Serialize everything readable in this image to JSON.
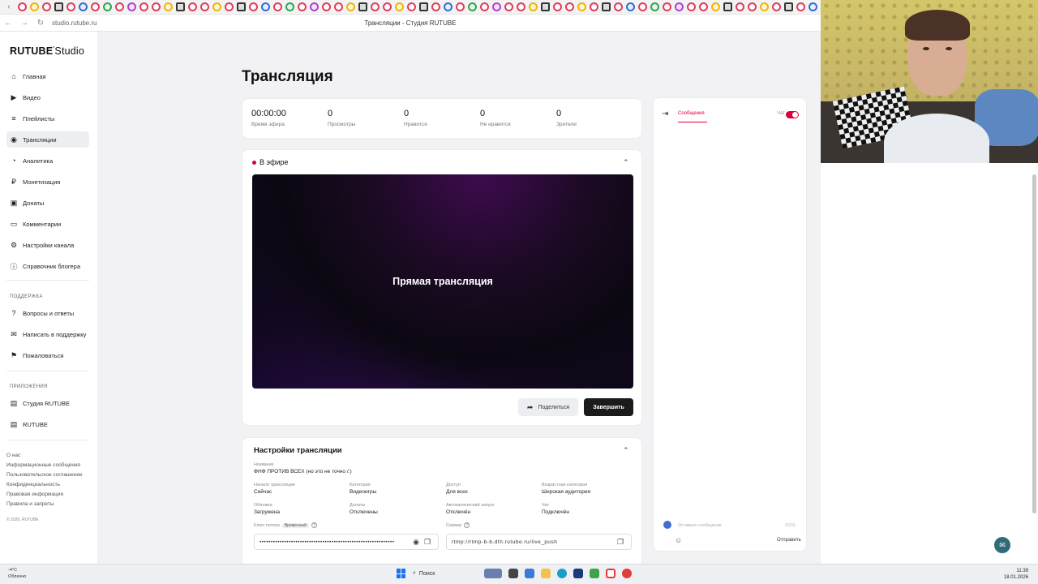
{
  "browser": {
    "url": "studio.rutube.ru",
    "page_title": "Трансляции - Студия RUTUBE"
  },
  "logo": {
    "brand": "RUTUBE",
    "product": "Studio"
  },
  "sidebar": {
    "items": [
      {
        "label": "Главная",
        "icon": "home-icon"
      },
      {
        "label": "Видео",
        "icon": "video-icon"
      },
      {
        "label": "Плейлисты",
        "icon": "playlist-icon"
      },
      {
        "label": "Трансляции",
        "icon": "broadcast-icon",
        "active": true
      },
      {
        "label": "Аналитика",
        "icon": "analytics-icon"
      },
      {
        "label": "Монетизация",
        "icon": "money-icon"
      },
      {
        "label": "Донаты",
        "icon": "donate-icon"
      },
      {
        "label": "Комментарии",
        "icon": "comments-icon"
      },
      {
        "label": "Настройки канала",
        "icon": "gear-icon"
      },
      {
        "label": "Справочник блогера",
        "icon": "info-icon"
      }
    ],
    "support_title": "ПОДДЕРЖКА",
    "support_items": [
      {
        "label": "Вопросы и ответы",
        "icon": "question-icon"
      },
      {
        "label": "Написать в поддержку",
        "icon": "mail-icon"
      },
      {
        "label": "Пожаловаться",
        "icon": "flag-icon"
      }
    ],
    "apps_title": "ПРИЛОЖЕНИЯ",
    "apps_items": [
      {
        "label": "Студия RUTUBE",
        "icon": "studio-app-icon"
      },
      {
        "label": "RUTUBE",
        "icon": "rutube-app-icon"
      }
    ],
    "footer": [
      "О нас",
      "Информационные сообщения",
      "Пользовательское соглашение",
      "Конфиденциальность",
      "Правовая информация",
      "Правила и запреты",
      "© 2026, RUTUBE"
    ]
  },
  "main": {
    "title": "Трансляция",
    "stats": [
      {
        "value": "00:00:00",
        "label": "Время эфира"
      },
      {
        "value": "0",
        "label": "Просмотры"
      },
      {
        "value": "0",
        "label": "Нравится"
      },
      {
        "value": "0",
        "label": "Не нравится"
      },
      {
        "value": "0",
        "label": "Зрители"
      }
    ],
    "live": {
      "status": "В эфире",
      "player_text": "Прямая трансляция",
      "share_label": "Поделиться",
      "end_label": "Завершить"
    },
    "settings": {
      "title": "Настройки трансляции",
      "name_label": "Название",
      "name_value": "ФНФ ПРОТИВ ВСЕХ (но это не точно /:)",
      "fields": [
        {
          "label": "Начало трансляции",
          "value": "Сейчас"
        },
        {
          "label": "Категория",
          "value": "Видеоигры"
        },
        {
          "label": "Доступ",
          "value": "Для всех"
        },
        {
          "label": "Возрастная категория",
          "value": "Широкая аудитория"
        },
        {
          "label": "Обложка",
          "value": "Загружена"
        },
        {
          "label": "Донаты",
          "value": "Отключены"
        },
        {
          "label": "Автоматический запуск",
          "value": "Отключён"
        },
        {
          "label": "Чат",
          "value": "Подключён"
        }
      ],
      "key_label": "Ключ потока",
      "key_tag": "Временный",
      "key_mask": "••••••••••••••••••••••••••••••••••••••••••••••••••••••••••••",
      "server_label": "Сервер",
      "server_value": "rtmp://rtmp-b-b.dth.rutube.ru/live_push"
    }
  },
  "chat": {
    "tab_label": "Сообщения",
    "toggle_label": "Чат",
    "input_placeholder": "Оставьте сообщение",
    "counter": "0/200",
    "send_label": "Отправить"
  },
  "taskbar": {
    "weather_temp": "-4°C",
    "weather_desc": "Облачно",
    "search_label": "Поиск",
    "time": "11:39",
    "date": "18.01.2026"
  },
  "colors": {
    "accent": "#d9003a",
    "dark_button": "#1b1b1b"
  }
}
